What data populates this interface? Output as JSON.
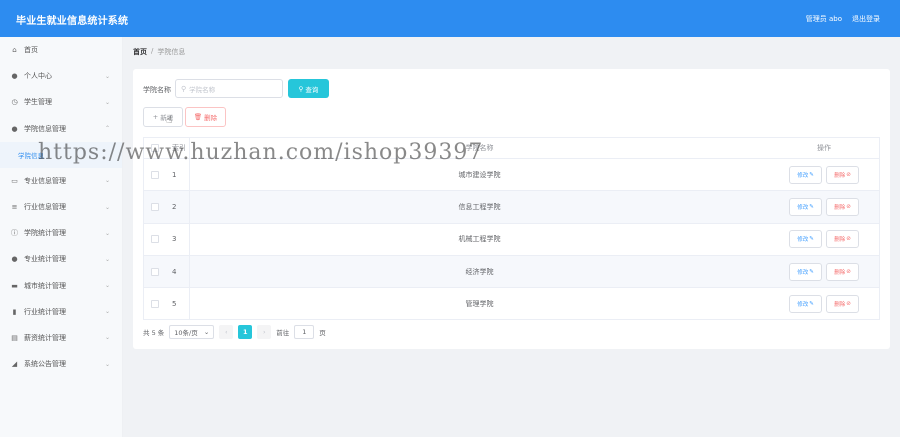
{
  "header": {
    "app_title": "毕业生就业信息统计系统",
    "user_label": "管理员 abo",
    "logout_label": "退出登录"
  },
  "sidebar": {
    "items": [
      {
        "label": "首页",
        "icon": "home-icon",
        "glyph": "⌂"
      },
      {
        "label": "个人中心",
        "icon": "user-icon",
        "glyph": "●"
      },
      {
        "label": "学生管理",
        "icon": "clock-icon",
        "glyph": "◷"
      },
      {
        "label": "学院信息管理",
        "icon": "location-icon",
        "glyph": "●"
      },
      {
        "label": "专业信息管理",
        "icon": "message-icon",
        "glyph": "▭"
      },
      {
        "label": "行业信息管理",
        "icon": "sliders-icon",
        "glyph": "≡"
      },
      {
        "label": "学院统计管理",
        "icon": "info-icon",
        "glyph": "ⓘ"
      },
      {
        "label": "专业统计管理",
        "icon": "user-icon",
        "glyph": "●"
      },
      {
        "label": "城市统计管理",
        "icon": "monitor-icon",
        "glyph": "▬"
      },
      {
        "label": "行业统计管理",
        "icon": "bar-chart-icon",
        "glyph": "▮"
      },
      {
        "label": "薪资统计管理",
        "icon": "document-icon",
        "glyph": "▤"
      },
      {
        "label": "系统公告管理",
        "icon": "megaphone-icon",
        "glyph": "◢"
      }
    ],
    "submenu": {
      "label": "学院信息"
    }
  },
  "breadcrumb": {
    "home": "首页",
    "separator": "/",
    "current": "学院信息"
  },
  "search": {
    "label": "学院名称",
    "placeholder": "学院名称",
    "button_label": "查询"
  },
  "toolbar": {
    "add_label": "新增",
    "delete_label": "删除"
  },
  "table": {
    "headers": {
      "index": "索引",
      "name": "学院名称",
      "actions": "操作"
    },
    "rows": [
      {
        "index": "1",
        "name": "城市建设学院"
      },
      {
        "index": "2",
        "name": "信息工程学院"
      },
      {
        "index": "3",
        "name": "机械工程学院"
      },
      {
        "index": "4",
        "name": "经济学院"
      },
      {
        "index": "5",
        "name": "管理学院"
      }
    ],
    "edit_label": "修改",
    "delete_label": "删除"
  },
  "pagination": {
    "total_text": "共 5 条",
    "page_size": "10条/页",
    "current_page": "1",
    "goto_prefix": "前往",
    "goto_value": "1",
    "goto_suffix": "页"
  },
  "watermark": "https://www.huzhan.com/ishop39397",
  "colors": {
    "header": "#2d8cf0",
    "accent": "#26c6da",
    "danger": "#f56c6c",
    "link": "#409eff"
  }
}
